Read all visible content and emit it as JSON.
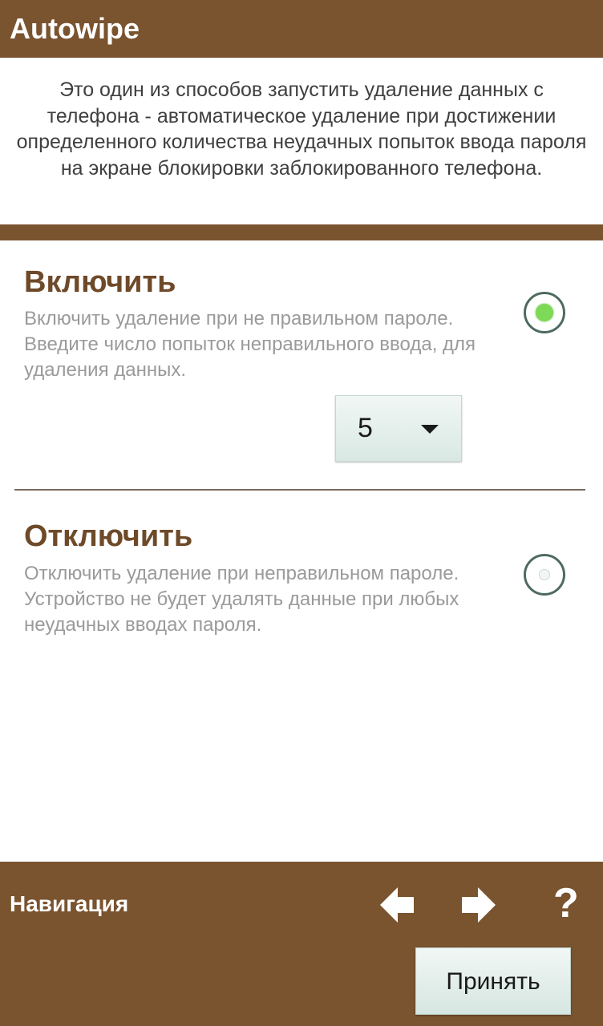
{
  "header": {
    "title": "Autowipe"
  },
  "intro": {
    "text": "Это один из способов запустить удаление данных с телефона - автоматическое удаление при достижении определенного количества неудачных попыток ввода пароля на экране блокировки заблокированного телефона."
  },
  "options": {
    "enable": {
      "title": "Включить",
      "description": "Включить удаление при не правильном пароле. Введите число попыток неправильного ввода, для удаления данных.",
      "selected": true
    },
    "disable": {
      "title": "Отключить",
      "description": "Отключить удаление при неправильном пароле. Устройство не будет удалять данные при любых неудачных вводах пароля.",
      "selected": false
    }
  },
  "attempts": {
    "selected_value": "5"
  },
  "footer": {
    "nav_label": "Навигация",
    "help_label": "?",
    "accept_label": "Принять"
  },
  "colors": {
    "brand_brown": "#7a532f",
    "title_brown": "#6e4a29",
    "radio_on": "#7ed957"
  },
  "icons": {
    "back": "arrow-left-icon",
    "forward": "arrow-right-icon",
    "help": "help-icon"
  }
}
